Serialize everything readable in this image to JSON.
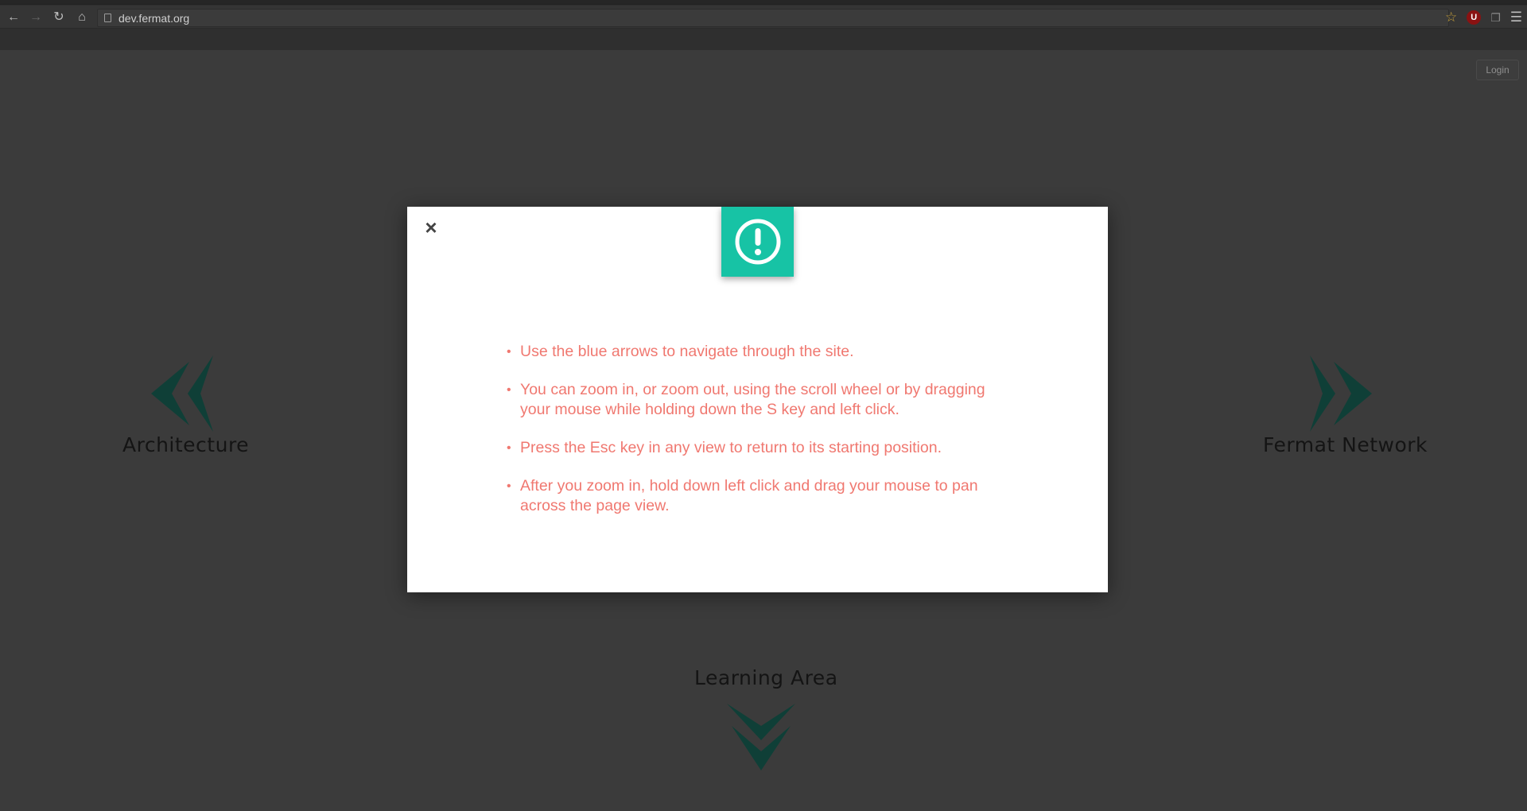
{
  "browser": {
    "url": "dev.fermat.org",
    "icons": {
      "back": "arrow-left-icon",
      "forward": "arrow-right-icon",
      "reload": "reload-icon",
      "home": "home-icon",
      "bookmark": "star-icon",
      "extension_ublock_label": "U",
      "menu": "hamburger-menu-icon"
    }
  },
  "page": {
    "login_label": "Login",
    "nav": {
      "left_label": "Architecture",
      "right_label": "Fermat Network",
      "bottom_label": "Learning Area"
    },
    "colors": {
      "arrow": "#0f3f37",
      "accent": "#17c3a5",
      "tip_text": "#f07870"
    }
  },
  "modal": {
    "close_label": "×",
    "badge_icon": "exclamation-circle-icon",
    "tips": [
      "Use the blue arrows to navigate through the site.",
      "You can zoom in, or zoom out, using the scroll wheel or by dragging your mouse while holding down the S key and left click.",
      "Press the Esc key in any view to return to its starting position.",
      "After you zoom in, hold down left click and drag your mouse to pan across the page view."
    ]
  }
}
